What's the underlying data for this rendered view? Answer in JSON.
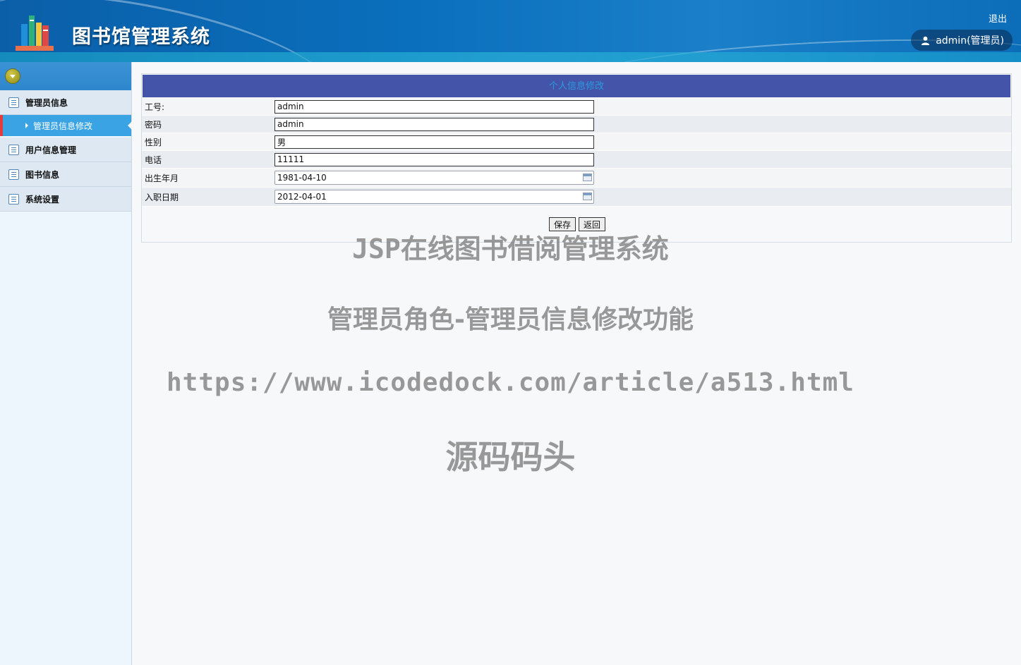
{
  "header": {
    "title": "图书馆管理系统",
    "logout": "退出",
    "user_label": "admin(管理员)"
  },
  "sidebar": {
    "items": [
      {
        "label": "管理员信息",
        "children": [
          {
            "label": "管理员信息修改",
            "active": true
          }
        ]
      },
      {
        "label": "用户信息管理"
      },
      {
        "label": "图书信息"
      },
      {
        "label": "系统设置"
      }
    ]
  },
  "form": {
    "title": "个人信息修改",
    "fields": [
      {
        "label": "工号:",
        "value": "admin"
      },
      {
        "label": "密码",
        "value": "admin"
      },
      {
        "label": "性别",
        "value": "男"
      },
      {
        "label": "电话",
        "value": "11111"
      },
      {
        "label": "出生年月",
        "value": "1981-04-10"
      },
      {
        "label": "入职日期",
        "value": "2012-04-01"
      }
    ],
    "save_label": "保存",
    "back_label": "返回"
  },
  "watermark": {
    "line1": "JSP在线图书借阅管理系统",
    "line2": "管理员角色-管理员信息修改功能",
    "line3": "https://www.icodedock.com/article/a513.html",
    "line4": "源码码头"
  },
  "colors": {
    "header_blue": "#0a6fbd",
    "panel_title_bg": "#4454a8",
    "active_menu": "#3aa3e3"
  }
}
